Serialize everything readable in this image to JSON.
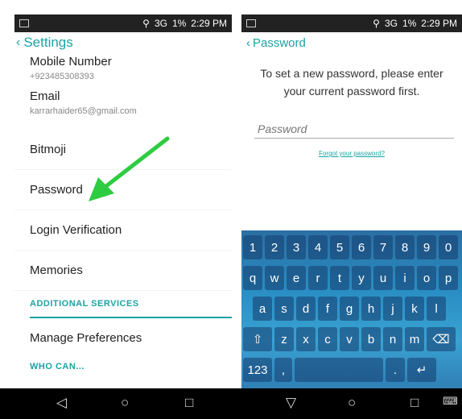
{
  "left": {
    "status_time": "2:29 PM",
    "status_battery": "1%",
    "status_network": "3G",
    "header_title": "Settings",
    "mobile": {
      "title": "Mobile Number",
      "value": "+923485308393"
    },
    "email": {
      "title": "Email",
      "value": "karrarhaider65@gmail.com"
    },
    "rows": [
      "Bitmoji",
      "Password",
      "Login Verification",
      "Memories"
    ],
    "section_additional": "ADDITIONAL SERVICES",
    "manage": "Manage Preferences",
    "section_who": "WHO CAN..."
  },
  "right": {
    "status_time": "2:29 PM",
    "status_battery": "1%",
    "status_network": "3G",
    "header_title": "Password",
    "instruction": "To set a new password, please enter your current password first.",
    "password_placeholder": "Password",
    "forgot_link": "Forgot your password?",
    "keyboard": {
      "row1": [
        "1",
        "2",
        "3",
        "4",
        "5",
        "6",
        "7",
        "8",
        "9",
        "0"
      ],
      "row2": [
        "q",
        "w",
        "e",
        "r",
        "t",
        "y",
        "u",
        "i",
        "o",
        "p"
      ],
      "row3": [
        "a",
        "s",
        "d",
        "f",
        "g",
        "h",
        "j",
        "k",
        "l"
      ],
      "row4": [
        "z",
        "x",
        "c",
        "v",
        "b",
        "n",
        "m"
      ],
      "num_label": "123",
      "comma": ","
    }
  },
  "colors": {
    "accent": "#1aa3a3",
    "arrow": "#2ecc40",
    "keyboard": "#2a8fc4"
  }
}
